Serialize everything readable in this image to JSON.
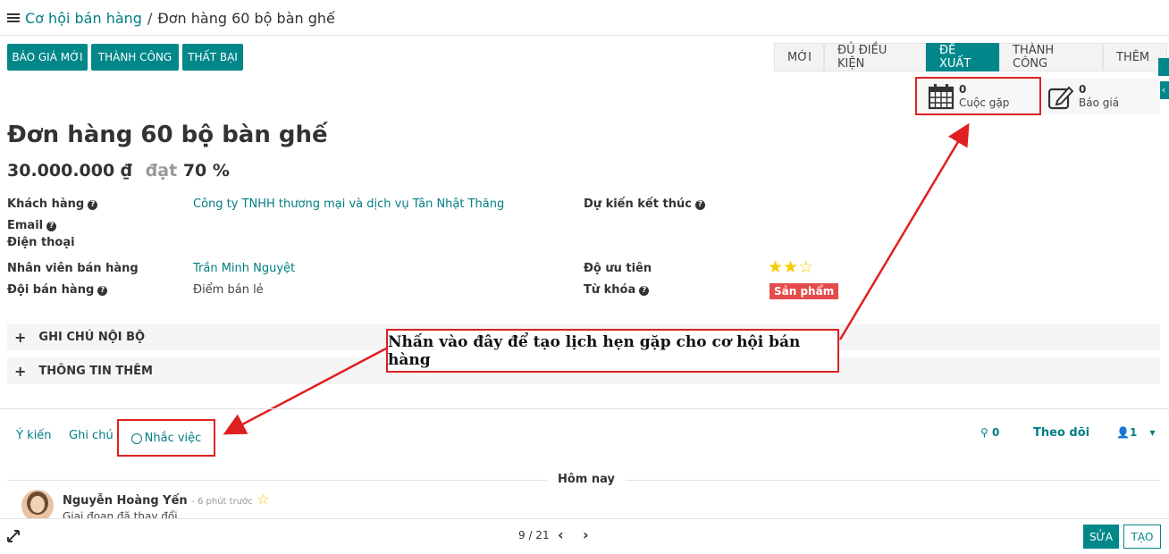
{
  "breadcrumb": {
    "parent": "Cơ hội bán hàng",
    "separator": "/",
    "current": "Đơn hàng 60 bộ bàn ghế"
  },
  "actions": {
    "new_quote": "BÁO GIÁ MỚI",
    "won": "THÀNH CÔNG",
    "lost": "THẤT BẠI"
  },
  "stages": [
    "MỚI",
    "ĐỦ ĐIỀU KIỆN",
    "ĐỀ XUẤT",
    "THÀNH CÔNG",
    "THÊM"
  ],
  "active_stage": "ĐỀ XUẤT",
  "smart_buttons": {
    "meetings": {
      "count": "0",
      "label": "Cuộc gặp"
    },
    "quotes": {
      "count": "0",
      "label": "Báo giá"
    }
  },
  "record": {
    "title": "Đơn hàng 60 bộ bàn ghế",
    "revenue": "30.000.000 ₫",
    "prob_prefix": "đạt",
    "probability": "70 %"
  },
  "fields": {
    "customer_label": "Khách hàng",
    "customer_value": "Công ty TNHH thương mại và dịch vụ Tân Nhật Thăng",
    "email_label": "Email",
    "phone_label": "Điện thoại",
    "salesperson_label": "Nhân viên bán hàng",
    "salesperson_value": "Trần Minh Nguyệt",
    "team_label": "Đội bán hàng",
    "team_value": "Điểm bán lẻ",
    "deadline_label": "Dự kiến kết thúc",
    "priority_label": "Độ ưu tiên",
    "priority_level": 2,
    "priority_max": 3,
    "tags_label": "Từ khóa",
    "tag_value": "Sản phẩm"
  },
  "sections": {
    "internal_notes": "GHI CHÚ NỘI BỘ",
    "extra_info": "THÔNG TIN THÊM",
    "expand_glyph": "+"
  },
  "callout_text": "Nhấn vào đây để tạo lịch hẹn gặp cho cơ hội bán hàng",
  "chatter": {
    "tab_message": "Ý kiến",
    "tab_note": "Ghi chú",
    "tab_activity": "Nhắc việc",
    "attachments": "0",
    "follow": "Theo dõi",
    "followers": "1",
    "date_separator": "Hôm nay",
    "author": "Nguyễn Hoàng Yến",
    "time": "- 6 phút trước",
    "message": "Giai đoạn đã thay đổi"
  },
  "pager": {
    "value": "9 / 21"
  },
  "footer": {
    "edit": "SỬA",
    "create": "TẠO"
  },
  "colors": {
    "brand": "#00878a",
    "link": "#017e84",
    "annotation": "#e02020",
    "tag": "#e44c4c",
    "star": "#f3cc00"
  }
}
